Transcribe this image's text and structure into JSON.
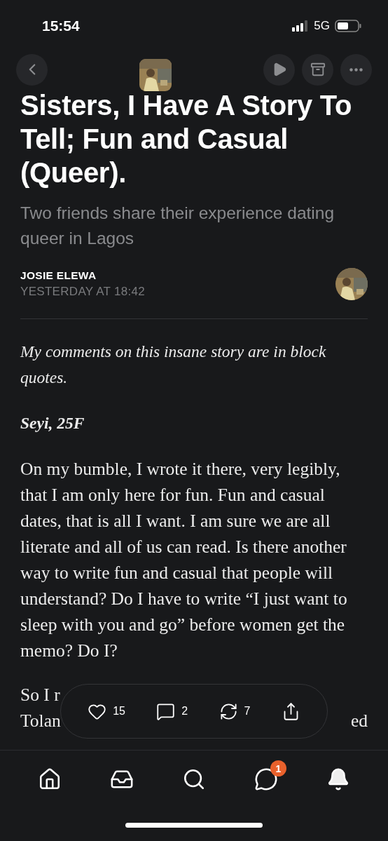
{
  "status_bar": {
    "time": "15:54",
    "network": "5G"
  },
  "article": {
    "title": "Sisters, I Have A Story To Tell; Fun and Casual (Queer).",
    "subtitle": "Two friends share their experience dating queer in Lagos",
    "author": "JOSIE ELEWA",
    "date": "YESTERDAY AT 18:42",
    "paragraphs": [
      {
        "kind": "italic",
        "text": "My comments on this insane story are in block quotes."
      },
      {
        "kind": "heading",
        "text": "Seyi, 25F"
      },
      {
        "kind": "plain",
        "text": "On my bumble, I wrote it there, very legibly, that I am only here for fun. Fun and casual dates, that is all I want. I am sure we are all literate and all of us can read. Is there another way to write fun and casual that people will understand? Do I have to write “I just want to sleep with you and go” before women get the memo? Do I?"
      }
    ],
    "covered_lines": [
      {
        "left": "So I r"
      },
      {
        "left": "Tolan",
        "right": "ed"
      }
    ]
  },
  "actions": [
    {
      "kind": "like",
      "count": "15"
    },
    {
      "kind": "comment",
      "count": "2"
    },
    {
      "kind": "restack",
      "count": "7"
    },
    {
      "kind": "share"
    }
  ],
  "nav": [
    {
      "kind": "home"
    },
    {
      "kind": "inbox"
    },
    {
      "kind": "search"
    },
    {
      "kind": "chat",
      "badge": "1"
    },
    {
      "kind": "notifications"
    }
  ]
}
